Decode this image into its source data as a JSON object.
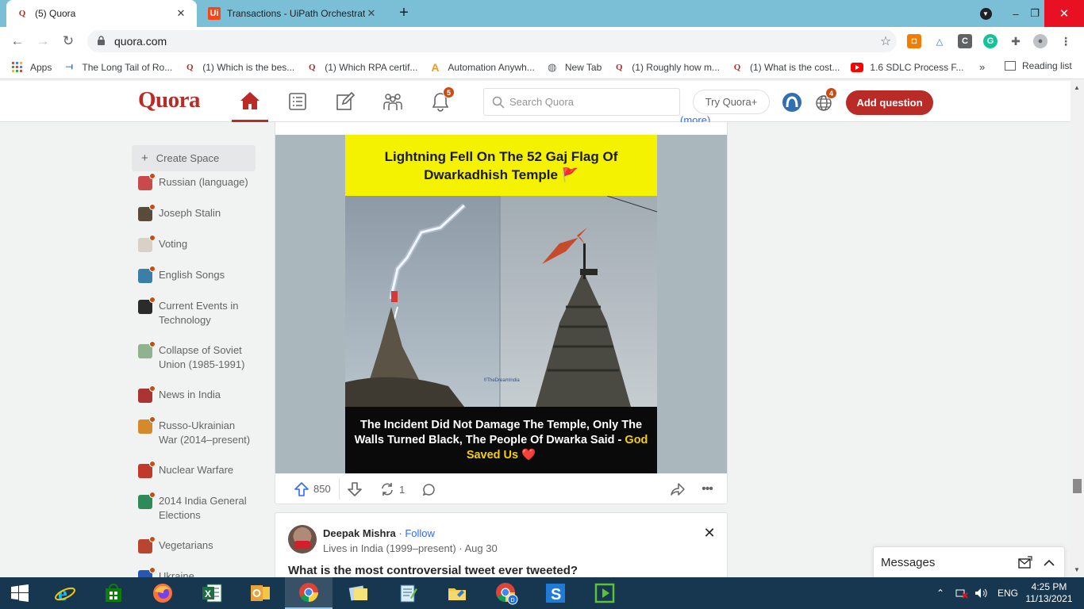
{
  "browser": {
    "tabs": [
      {
        "title": "(5) Quora",
        "favicon": "quora-icon",
        "active": true
      },
      {
        "title": "Transactions - UiPath Orchestrato",
        "favicon": "uipath-icon",
        "active": false
      }
    ],
    "new_tab_label": "+",
    "window_controls": {
      "minimize": "–",
      "maximize": "❐",
      "close": "✕"
    },
    "url": "quora.com",
    "bookmarks": [
      {
        "label": "Apps",
        "icon": "apps-grid-icon"
      },
      {
        "label": "The Long Tail of Ro...",
        "icon": "link-icon"
      },
      {
        "label": "(1) Which is the bes...",
        "icon": "quora-icon"
      },
      {
        "label": "(1) Which RPA certif...",
        "icon": "quora-icon"
      },
      {
        "label": "Automation Anywh...",
        "icon": "automation-anywhere-icon"
      },
      {
        "label": "New Tab",
        "icon": "globe-icon"
      },
      {
        "label": "(1) Roughly how m...",
        "icon": "quora-icon"
      },
      {
        "label": "(1) What is the cost...",
        "icon": "quora-icon"
      },
      {
        "label": "1.6 SDLC Process F...",
        "icon": "youtube-icon"
      }
    ],
    "bookmarks_more": "»",
    "reading_list": "Reading list"
  },
  "quora": {
    "logo": "Quora",
    "notification_badge": "5",
    "language_badge": "4",
    "search_placeholder": "Search Quora",
    "try_plus": "Try Quora+",
    "add_question": "Add question",
    "brand_color": "#b92b27"
  },
  "sidebar": {
    "create_space": "Create Space",
    "items": [
      {
        "label": "Russian (language)",
        "color": "#c94a4a"
      },
      {
        "label": "Joseph Stalin",
        "color": "#5a4a3a"
      },
      {
        "label": "Voting",
        "color": "#d9d0c8"
      },
      {
        "label": "English Songs",
        "color": "#3b7fa8"
      },
      {
        "label": "Current Events in Technology",
        "color": "#2b2b2b"
      },
      {
        "label": "Collapse of Soviet Union (1985-1991)",
        "color": "#8fb28f"
      },
      {
        "label": "News in India",
        "color": "#a33"
      },
      {
        "label": "Russo-Ukrainian War (2014–present)",
        "color": "#d48a2a"
      },
      {
        "label": "Nuclear Warfare",
        "color": "#c0392b"
      },
      {
        "label": "2014 India General Elections",
        "color": "#2e8b57"
      },
      {
        "label": "Vegetarians",
        "color": "#b8452e"
      },
      {
        "label": "Ukraine",
        "color": "#2458b5"
      }
    ]
  },
  "post1": {
    "more_link": "(more)",
    "image_headline": "Lightning Fell On The 52 Gaj Flag Of Dwarkadhish Temple 🚩",
    "image_caption_main": "The Incident Did Not Damage The Temple, Only The Walls Turned Black, The People Of Dwarka Said - ",
    "image_caption_highlight": "God Saved Us ❤️",
    "watermark": "f/TheDreamIndia",
    "upvotes": "850",
    "shares": "1"
  },
  "post2": {
    "author": "Deepak Mishra",
    "separator": " · ",
    "follow": "Follow",
    "credential": "Lives in India (1999–present)",
    "date": "Aug 30",
    "question": "What is the most controversial tweet ever tweeted?"
  },
  "messages": {
    "title": "Messages"
  },
  "taskbar": {
    "apps": [
      "windows-start-icon",
      "internet-explorer-icon",
      "store-icon",
      "firefox-icon",
      "excel-icon",
      "outlook-icon",
      "chrome-icon",
      "sticky-notes-icon",
      "notepad-icon",
      "file-explorer-icon",
      "chrome-profile-icon",
      "uipath-studio-icon",
      "play-icon"
    ],
    "language": "ENG",
    "time": "4:25 PM",
    "date": "11/13/2021"
  }
}
